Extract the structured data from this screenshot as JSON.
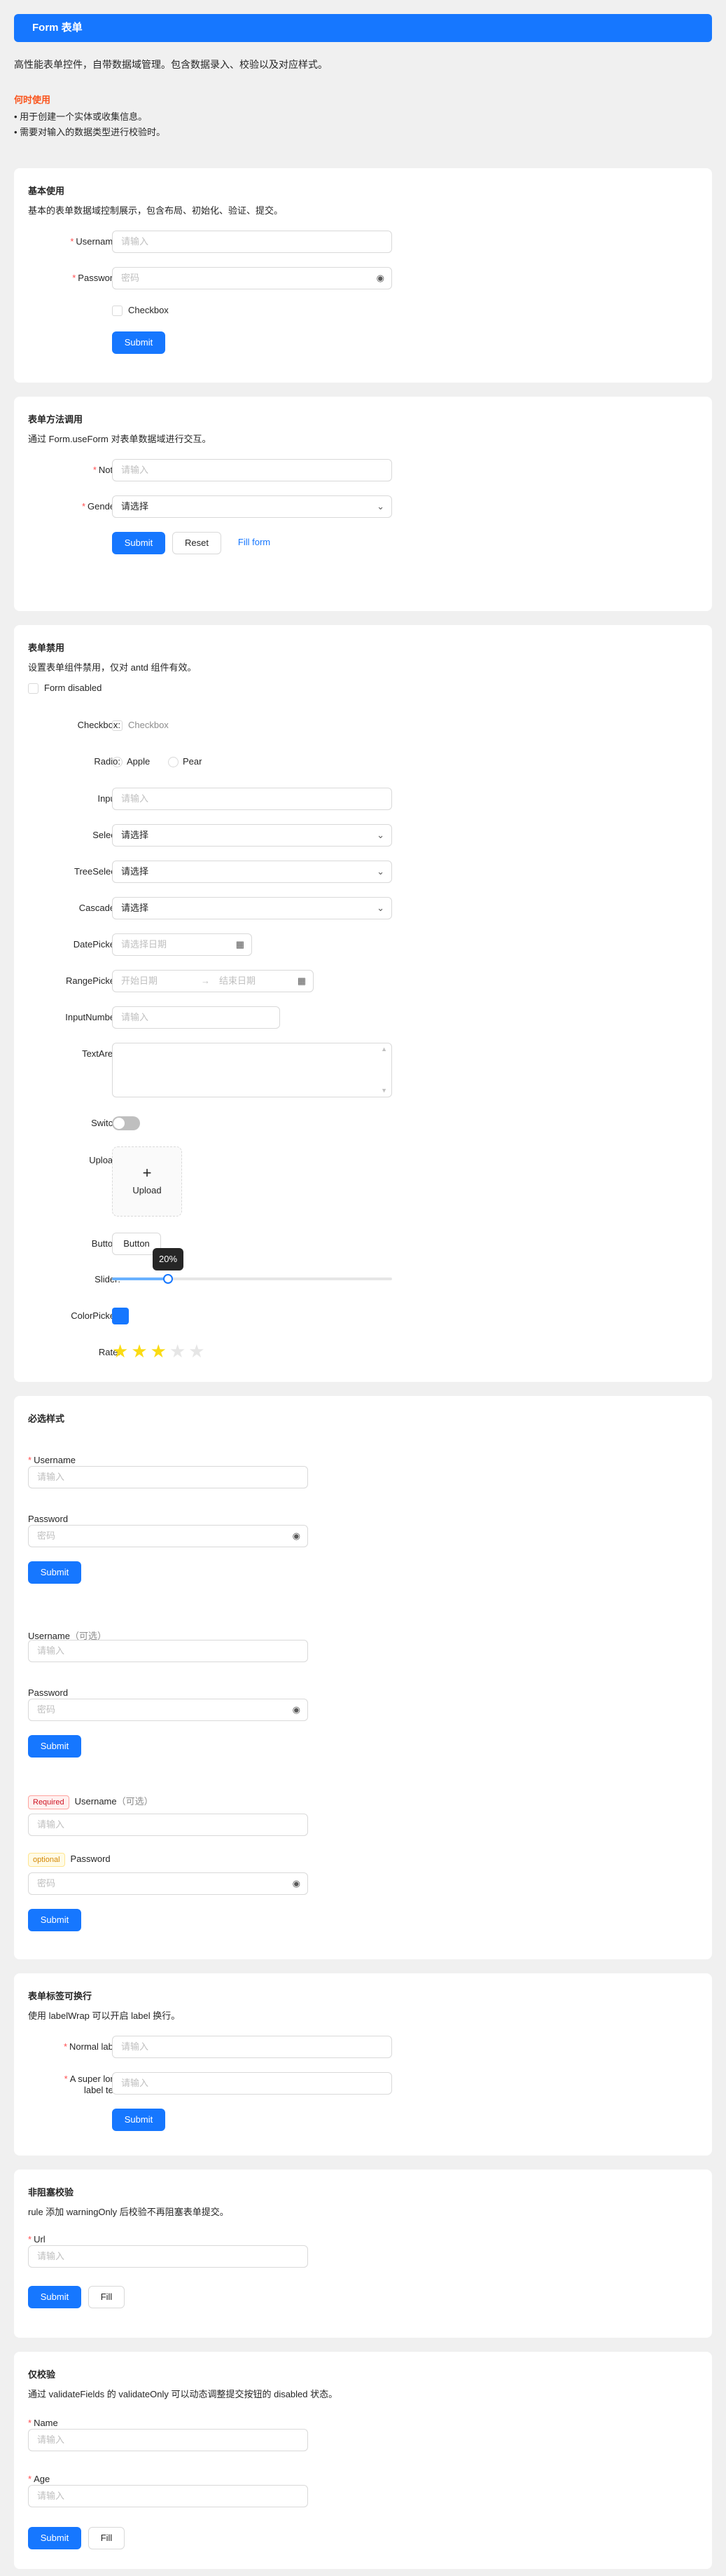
{
  "header": {
    "title": "Form 表单"
  },
  "intro": "高性能表单控件，自带数据域管理。包含数据录入、校验以及对应样式。",
  "when": {
    "title": "何时使用",
    "items": [
      "• 用于创建一个实体或收集信息。",
      "• 需要对输入的数据类型进行校验时。"
    ]
  },
  "basic": {
    "title": "基本使用",
    "desc": "基本的表单数据域控制展示，包含布局、初始化、验证、提交。",
    "username_label": "Username:",
    "username_ph": "请输入",
    "password_label": "Password:",
    "password_ph": "密码",
    "checkbox": "Checkbox",
    "submit": "Submit"
  },
  "method": {
    "title": "表单方法调用",
    "desc": "通过 Form.useForm 对表单数据域进行交互。",
    "note_label": "Note:",
    "note_ph": "请输入",
    "gender_label": "Gender:",
    "gender_ph": "请选择",
    "submit": "Submit",
    "reset": "Reset",
    "fill": "Fill form"
  },
  "disabled": {
    "title": "表单禁用",
    "desc": "设置表单组件禁用，仅对 antd 组件有效。",
    "form_disabled": "Form disabled",
    "checkbox_label": "Checkbox:",
    "checkbox_text": "Checkbox",
    "radio_label": "Radio:",
    "radio_apple": "Apple",
    "radio_pear": "Pear",
    "input_label": "Input:",
    "input_ph": "请输入",
    "select_label": "Select:",
    "select_ph": "请选择",
    "treeselect_label": "TreeSelect:",
    "treeselect_ph": "请选择",
    "cascader_label": "Cascader:",
    "cascader_ph": "请选择",
    "datepicker_label": "DatePicker:",
    "datepicker_ph": "请选择日期",
    "rangepicker_label": "RangePicker:",
    "range_start": "开始日期",
    "range_end": "结束日期",
    "inputnumber_label": "InputNumber:",
    "inputnumber_ph": "请输入",
    "textarea_label": "TextArea:",
    "switch_label": "Switch:",
    "upload_label": "Upload:",
    "upload_text": "Upload",
    "button_label": "Button:",
    "button_text": "Button",
    "slider_label": "Slider:",
    "slider_value": 0.2,
    "slider_tip": "20%",
    "colorpicker_label": "ColorPicker:",
    "color": "#1677ff",
    "rate_label": "Rate:",
    "rate_value": 3,
    "rate_max": 5
  },
  "required": {
    "title": "必选样式",
    "username": "Username",
    "password": "Password",
    "username_ph": "请输入",
    "password_ph": "密码",
    "submit": "Submit",
    "optional": "（可选）",
    "tag_required": "Required",
    "tag_optional": "optional"
  },
  "wrap": {
    "title": "表单标签可换行",
    "desc": "使用 labelWrap 可以开启 label 换行。",
    "normal_label": "Normal label",
    "long_label_1": "A super long",
    "long_label_2": "label text",
    "ph": "请输入",
    "submit": "Submit"
  },
  "warning": {
    "title": "非阻塞校验",
    "desc": "rule 添加 warningOnly 后校验不再阻塞表单提交。",
    "url_label": "Url",
    "ph": "请输入",
    "submit": "Submit",
    "fill": "Fill"
  },
  "validate": {
    "title": "仅校验",
    "desc": "通过 validateFields 的 validateOnly 可以动态调整提交按钮的 disabled 状态。",
    "name_label": "Name",
    "age_label": "Age",
    "ph": "请输入",
    "submit": "Submit",
    "fill": "Fill"
  },
  "colors": {
    "primary": "#1677ff",
    "danger": "#ff4d4f",
    "star": "#fadb14"
  }
}
